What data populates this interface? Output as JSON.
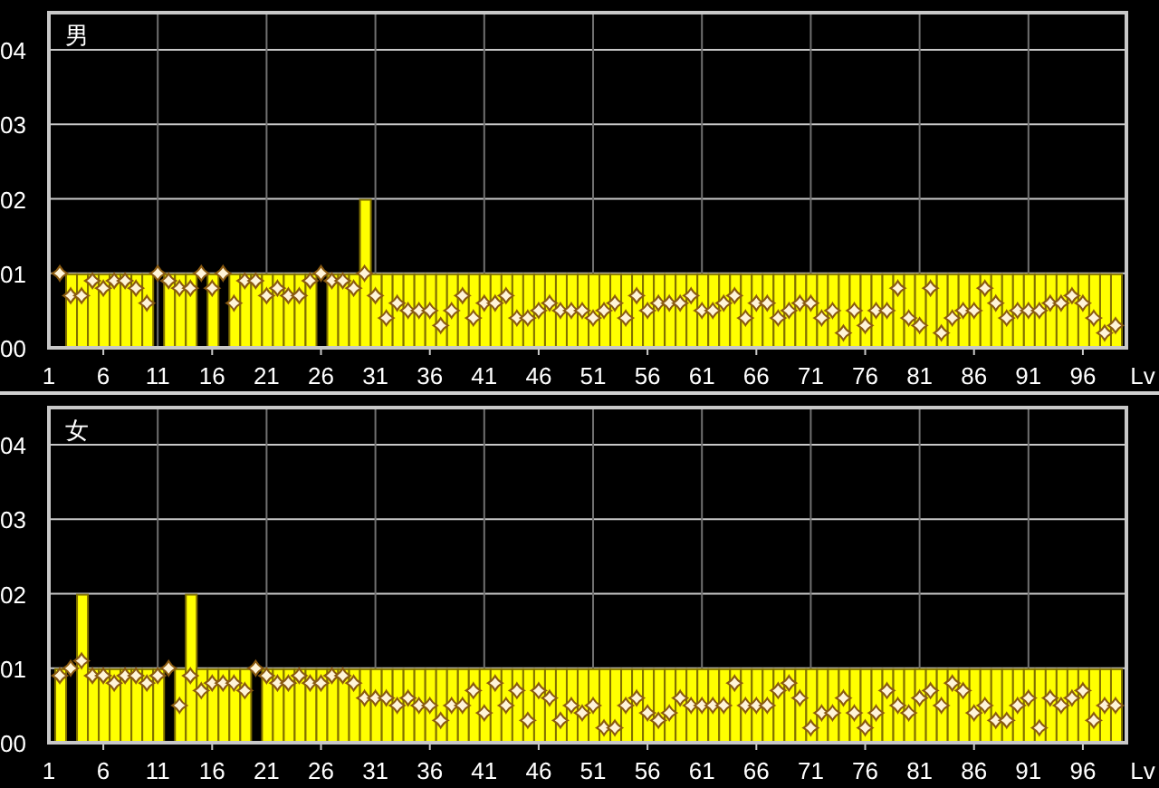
{
  "panels": [
    {
      "chart_data": {
        "type": "bar",
        "grid": true,
        "title": "男",
        "xlabel": "Lv",
        "x": [
          2,
          3,
          4,
          5,
          6,
          7,
          8,
          9,
          10,
          11,
          12,
          13,
          14,
          15,
          16,
          17,
          18,
          19,
          20,
          21,
          22,
          23,
          24,
          25,
          26,
          27,
          28,
          29,
          30,
          31,
          32,
          33,
          34,
          35,
          36,
          37,
          38,
          39,
          40,
          41,
          42,
          43,
          44,
          45,
          46,
          47,
          48,
          49,
          50,
          51,
          52,
          53,
          54,
          55,
          56,
          57,
          58,
          59,
          60,
          61,
          62,
          63,
          64,
          65,
          66,
          67,
          68,
          69,
          70,
          71,
          72,
          73,
          74,
          75,
          76,
          77,
          78,
          79,
          80,
          81,
          82,
          83,
          84,
          85,
          86,
          87,
          88,
          89,
          90,
          91,
          92,
          93,
          94,
          95,
          96,
          97,
          98,
          99
        ],
        "series": [
          {
            "color": "#ffff00",
            "values": [
              0,
              1,
              1,
              1,
              1,
              1,
              1,
              1,
              1,
              0,
              1,
              1,
              1,
              0,
              1,
              0,
              1,
              1,
              1,
              1,
              1,
              1,
              1,
              1,
              0,
              1,
              1,
              1,
              2,
              1,
              1,
              1,
              1,
              1,
              1,
              1,
              1,
              1,
              1,
              1,
              1,
              1,
              1,
              1,
              1,
              1,
              1,
              1,
              1,
              1,
              1,
              1,
              1,
              1,
              1,
              1,
              1,
              1,
              1,
              1,
              1,
              1,
              1,
              1,
              1,
              1,
              1,
              1,
              1,
              1,
              1,
              1,
              1,
              1,
              1,
              1,
              1,
              1,
              1,
              1,
              1,
              1,
              1,
              1,
              1,
              1,
              1,
              1,
              1,
              1,
              1,
              1,
              1,
              1,
              1,
              1,
              1,
              1
            ]
          },
          {
            "type": "scatter",
            "color": "#fff4d8",
            "values": [
              1.0,
              0.7,
              0.7,
              0.9,
              0.8,
              0.9,
              0.9,
              0.8,
              0.6,
              1.0,
              0.9,
              0.8,
              0.8,
              1.0,
              0.8,
              1.0,
              0.6,
              0.9,
              0.9,
              0.7,
              0.8,
              0.7,
              0.7,
              0.9,
              1.0,
              0.9,
              0.9,
              0.8,
              1.0,
              0.7,
              0.4,
              0.6,
              0.5,
              0.5,
              0.5,
              0.3,
              0.5,
              0.7,
              0.4,
              0.6,
              0.6,
              0.7,
              0.4,
              0.4,
              0.5,
              0.6,
              0.5,
              0.5,
              0.5,
              0.4,
              0.5,
              0.6,
              0.4,
              0.7,
              0.5,
              0.6,
              0.6,
              0.6,
              0.7,
              0.5,
              0.5,
              0.6,
              0.7,
              0.4,
              0.6,
              0.6,
              0.4,
              0.5,
              0.6,
              0.6,
              0.4,
              0.5,
              0.2,
              0.5,
              0.3,
              0.5,
              0.5,
              0.8,
              0.4,
              0.3,
              0.8,
              0.2,
              0.4,
              0.5,
              0.5,
              0.8,
              0.6,
              0.4,
              0.5,
              0.5,
              0.5,
              0.6,
              0.6,
              0.7,
              0.6,
              0.4,
              0.2,
              0.3
            ]
          }
        ],
        "xlim": [
          1,
          100
        ],
        "ylim": [
          0,
          4.5
        ],
        "xticks": [
          1,
          6,
          11,
          16,
          21,
          26,
          31,
          36,
          41,
          46,
          51,
          56,
          61,
          66,
          71,
          76,
          81,
          86,
          91,
          96
        ],
        "yticks": [
          {
            "value": 0,
            "label": "00"
          },
          {
            "value": 1,
            "label": "01"
          },
          {
            "value": 2,
            "label": "02"
          },
          {
            "value": 3,
            "label": "03"
          },
          {
            "value": 4,
            "label": "04"
          }
        ]
      }
    },
    {
      "chart_data": {
        "type": "bar",
        "grid": true,
        "title": "女",
        "xlabel": "Lv",
        "x": [
          2,
          3,
          4,
          5,
          6,
          7,
          8,
          9,
          10,
          11,
          12,
          13,
          14,
          15,
          16,
          17,
          18,
          19,
          20,
          21,
          22,
          23,
          24,
          25,
          26,
          27,
          28,
          29,
          30,
          31,
          32,
          33,
          34,
          35,
          36,
          37,
          38,
          39,
          40,
          41,
          42,
          43,
          44,
          45,
          46,
          47,
          48,
          49,
          50,
          51,
          52,
          53,
          54,
          55,
          56,
          57,
          58,
          59,
          60,
          61,
          62,
          63,
          64,
          65,
          66,
          67,
          68,
          69,
          70,
          71,
          72,
          73,
          74,
          75,
          76,
          77,
          78,
          79,
          80,
          81,
          82,
          83,
          84,
          85,
          86,
          87,
          88,
          89,
          90,
          91,
          92,
          93,
          94,
          95,
          96,
          97,
          98,
          99
        ],
        "series": [
          {
            "color": "#ffff00",
            "values": [
              1,
              0,
              2,
              1,
              1,
              1,
              1,
              1,
              1,
              1,
              0,
              1,
              2,
              1,
              1,
              1,
              1,
              1,
              0,
              1,
              1,
              1,
              1,
              1,
              1,
              1,
              1,
              1,
              1,
              1,
              1,
              1,
              1,
              1,
              1,
              1,
              1,
              1,
              1,
              1,
              1,
              1,
              1,
              1,
              1,
              1,
              1,
              1,
              1,
              1,
              1,
              1,
              1,
              1,
              1,
              1,
              1,
              1,
              1,
              1,
              1,
              1,
              1,
              1,
              1,
              1,
              1,
              1,
              1,
              1,
              1,
              1,
              1,
              1,
              1,
              1,
              1,
              1,
              1,
              1,
              1,
              1,
              1,
              1,
              1,
              1,
              1,
              1,
              1,
              1,
              1,
              1,
              1,
              1,
              1,
              1,
              1,
              1
            ]
          },
          {
            "type": "scatter",
            "color": "#fff4d8",
            "values": [
              0.9,
              1.0,
              1.1,
              0.9,
              0.9,
              0.8,
              0.9,
              0.9,
              0.8,
              0.9,
              1.0,
              0.5,
              0.9,
              0.7,
              0.8,
              0.8,
              0.8,
              0.7,
              1.0,
              0.9,
              0.8,
              0.8,
              0.9,
              0.8,
              0.8,
              0.9,
              0.9,
              0.8,
              0.6,
              0.6,
              0.6,
              0.5,
              0.6,
              0.5,
              0.5,
              0.3,
              0.5,
              0.5,
              0.7,
              0.4,
              0.8,
              0.5,
              0.7,
              0.3,
              0.7,
              0.6,
              0.3,
              0.5,
              0.4,
              0.5,
              0.2,
              0.2,
              0.5,
              0.6,
              0.4,
              0.3,
              0.4,
              0.6,
              0.5,
              0.5,
              0.5,
              0.5,
              0.8,
              0.5,
              0.5,
              0.5,
              0.7,
              0.8,
              0.6,
              0.2,
              0.4,
              0.4,
              0.6,
              0.4,
              0.2,
              0.4,
              0.7,
              0.5,
              0.4,
              0.6,
              0.7,
              0.5,
              0.8,
              0.7,
              0.4,
              0.5,
              0.3,
              0.3,
              0.5,
              0.6,
              0.2,
              0.6,
              0.5,
              0.6,
              0.7,
              0.3,
              0.5,
              0.5
            ]
          }
        ],
        "xlim": [
          1,
          100
        ],
        "ylim": [
          0,
          4.5
        ],
        "xticks": [
          1,
          6,
          11,
          16,
          21,
          26,
          31,
          36,
          41,
          46,
          51,
          56,
          61,
          66,
          71,
          76,
          81,
          86,
          91,
          96
        ],
        "yticks": [
          {
            "value": 0,
            "label": "00"
          },
          {
            "value": 1,
            "label": "01"
          },
          {
            "value": 2,
            "label": "02"
          },
          {
            "value": 3,
            "label": "03"
          },
          {
            "value": 4,
            "label": "04"
          }
        ]
      }
    }
  ]
}
